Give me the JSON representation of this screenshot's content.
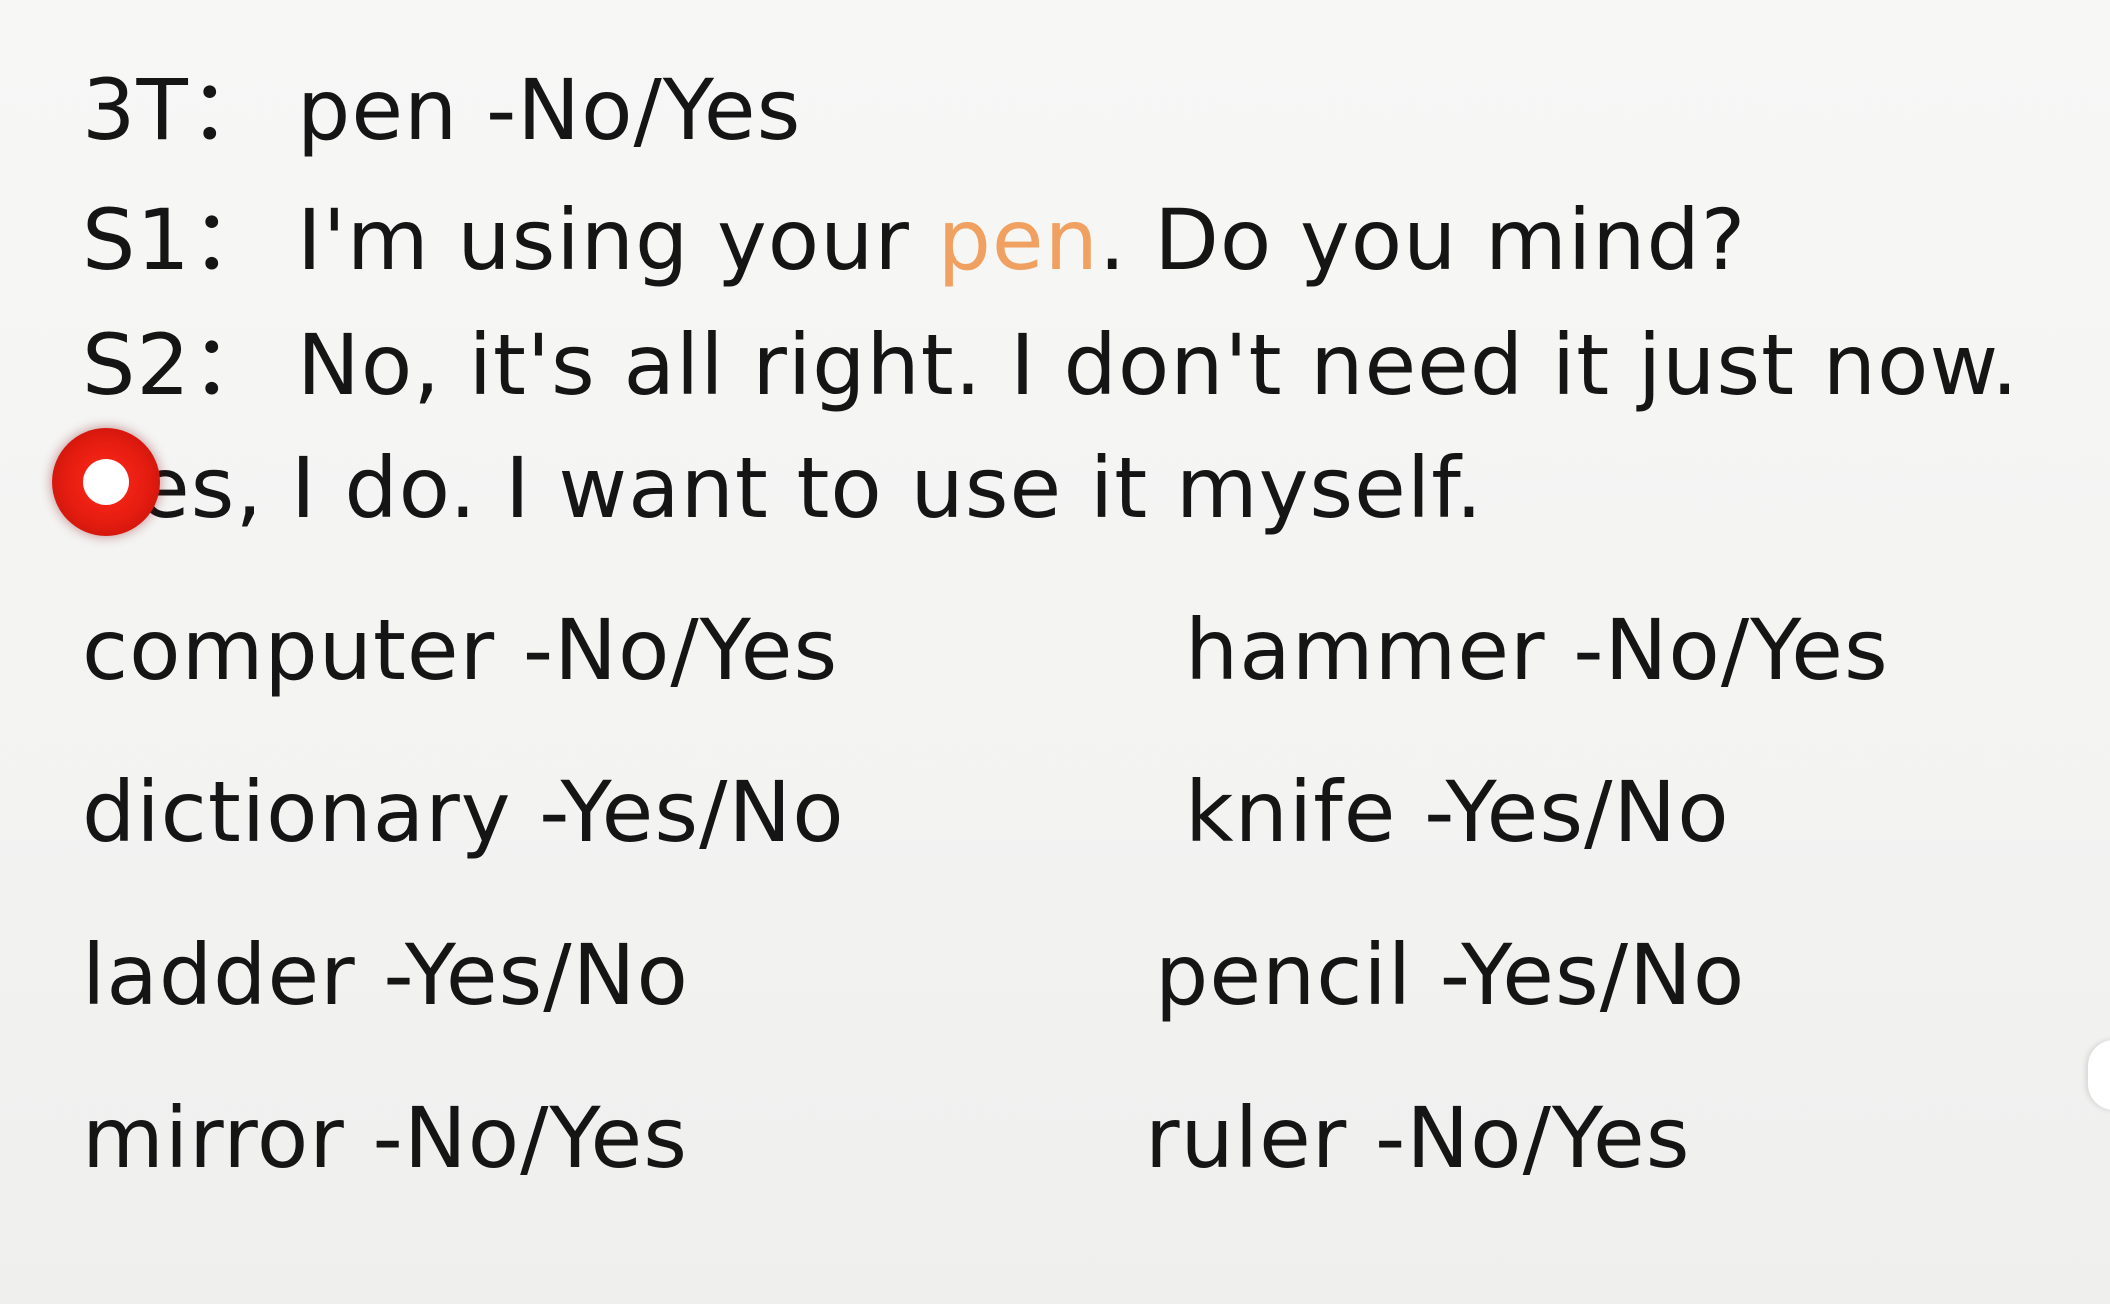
{
  "dialogue": {
    "line1": {
      "speaker": "3T：",
      "text": "pen -No/Yes"
    },
    "line2": {
      "speaker": "S1：",
      "text_before": "I'm using your ",
      "highlight": "pen",
      "text_after": ". Do you mind?"
    },
    "line3": {
      "speaker": "S2：",
      "text": "No, it's all right. I don't need it just now."
    },
    "line4": {
      "text": "es, I do. I want to use it myself."
    }
  },
  "vocabulary": {
    "left": [
      "computer -No/Yes",
      "dictionary -Yes/No",
      "ladder -Yes/No",
      "mirror -No/Yes"
    ],
    "right": [
      "hammer -No/Yes",
      "knife -Yes/No",
      "pencil -Yes/No",
      "ruler -No/Yes"
    ]
  },
  "colors": {
    "text": "#151515",
    "highlight": "#f0a060",
    "pointer": "#e41c10",
    "background": "#f5f5f4"
  },
  "icons": {
    "pointer": "red-dot-pointer-icon"
  }
}
